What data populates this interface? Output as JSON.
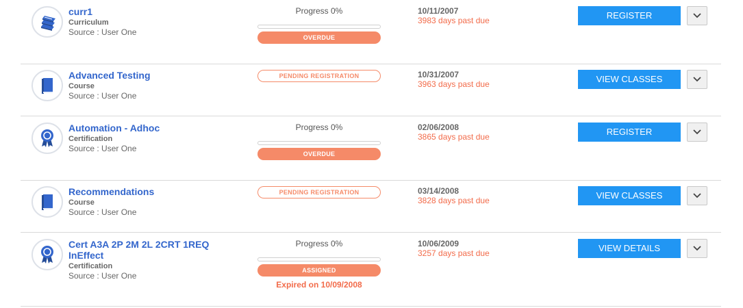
{
  "items": [
    {
      "title": "curr1",
      "type": "Curriculum",
      "source": "Source : User One",
      "icon": "curriculum-books-icon",
      "progress_label": "Progress 0%",
      "progress": 0,
      "status": "OVERDUE",
      "due_date": "10/11/2007",
      "past_due": "3983 days past due",
      "action": "REGISTER"
    },
    {
      "title": "Advanced Testing",
      "type": "Course",
      "source": "Source : User One",
      "icon": "course-book-icon",
      "status": "PENDING REGISTRATION",
      "due_date": "10/31/2007",
      "past_due": "3963 days past due",
      "action": "VIEW CLASSES"
    },
    {
      "title": "Automation - Adhoc",
      "type": "Certification",
      "source": "Source : User One",
      "icon": "certification-ribbon-icon",
      "progress_label": "Progress 0%",
      "progress": 0,
      "status": "OVERDUE",
      "due_date": "02/06/2008",
      "past_due": "3865 days past due",
      "action": "REGISTER"
    },
    {
      "title": "Recommendations",
      "type": "Course",
      "source": "Source : User One",
      "icon": "course-book-icon",
      "status": "PENDING REGISTRATION",
      "due_date": "03/14/2008",
      "past_due": "3828 days past due",
      "action": "VIEW CLASSES"
    },
    {
      "title_line1": "Cert A3A 2P 2M 2L 2CRT 1REQ",
      "title_line2": "InEffect",
      "type": "Certification",
      "source": "Source : User One",
      "icon": "certification-ribbon-icon",
      "progress_label": "Progress 0%",
      "progress": 0,
      "status": "ASSIGNED",
      "expired": "Expired on 10/09/2008",
      "due_date": "10/06/2009",
      "past_due": "3257 days past due",
      "action": "VIEW DETAILS"
    }
  ],
  "colors": {
    "title": "#3366cc",
    "status_orange": "#f58a68",
    "past_due_red": "#f26b4a",
    "button_blue": "#2196f3"
  }
}
